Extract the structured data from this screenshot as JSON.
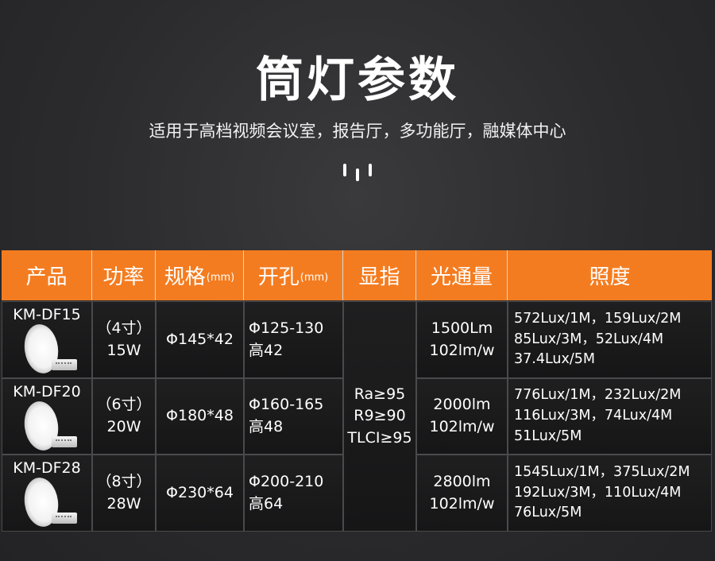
{
  "title": "筒灯参数",
  "subtitle": "适用于高档视频会议室，报告厅，多功能厅，融媒体中心",
  "table": {
    "headers": {
      "product": "产品",
      "power": "功率",
      "spec": "规格",
      "spec_unit": "(mm)",
      "cutout": "开孔",
      "cutout_unit": "(mm)",
      "cri": "显指",
      "flux": "光通量",
      "illuminance": "照度"
    },
    "cri_shared": {
      "line1": "Ra≥95",
      "line2": "R9≥90",
      "line3": "TLCI≥95"
    },
    "rows": [
      {
        "product": "KM-DF15",
        "power_line1": "（4寸）",
        "power_line2": "15W",
        "spec": "Φ145*42",
        "cutout_line1": "Φ125-130",
        "cutout_line2": "高42",
        "flux_line1": "1500Lm",
        "flux_line2": "102lm/w",
        "lux_line1": "572Lux/1M，159Lux/2M",
        "lux_line2": "85Lux/3M，52Lux/4M",
        "lux_line3": "37.4Lux/5M"
      },
      {
        "product": "KM-DF20",
        "power_line1": "（6寸）",
        "power_line2": "20W",
        "spec": "Φ180*48",
        "cutout_line1": "Φ160-165",
        "cutout_line2": "高48",
        "flux_line1": "2000lm",
        "flux_line2": "102lm/w",
        "lux_line1": "776Lux/1M，232Lux/2M",
        "lux_line2": "116Lux/3M，74Lux/4M",
        "lux_line3": "51Lux/5M"
      },
      {
        "product": "KM-DF28",
        "power_line1": "（8寸）",
        "power_line2": "28W",
        "spec": "Φ230*64",
        "cutout_line1": "Φ200-210",
        "cutout_line2": "高64",
        "flux_line1": "2800lm",
        "flux_line2": "102lm/w",
        "lux_line1": "1545Lux/1M，375Lux/2M",
        "lux_line2": "192Lux/3M，110Lux/4M",
        "lux_line3": "76Lux/5M"
      }
    ]
  },
  "colors": {
    "header_bg": "#f47c20",
    "page_bg": "#2a2a2c",
    "cell_bg": "#1b1b1c"
  }
}
